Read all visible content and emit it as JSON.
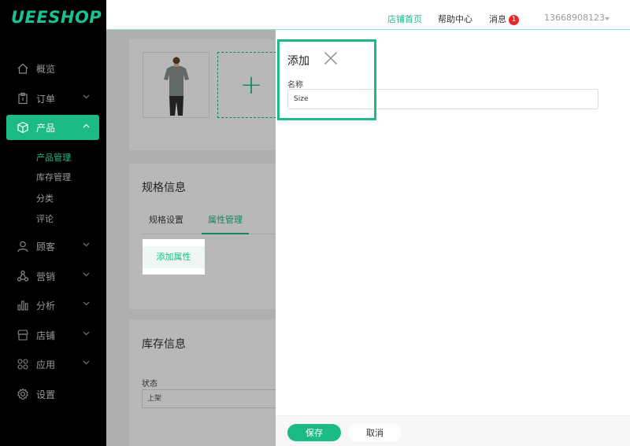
{
  "logo": "UEESHOP",
  "header": {
    "store_home": "店铺首页",
    "help_center": "帮助中心",
    "messages": "消息",
    "message_count": "1",
    "phone": "13668908123"
  },
  "sidebar": {
    "items": [
      {
        "label": "概览",
        "icon": "home-icon"
      },
      {
        "label": "订单",
        "icon": "clipboard-icon"
      },
      {
        "label": "产品",
        "icon": "box-icon"
      },
      {
        "label": "顾客",
        "icon": "user-icon"
      },
      {
        "label": "营销",
        "icon": "nodes-icon"
      },
      {
        "label": "分析",
        "icon": "bar-chart-icon"
      },
      {
        "label": "店铺",
        "icon": "store-icon"
      },
      {
        "label": "应用",
        "icon": "apps-icon"
      },
      {
        "label": "设置",
        "icon": "gear-icon"
      }
    ],
    "product_sub": [
      "产品管理",
      "库存管理",
      "分类",
      "评论"
    ]
  },
  "main": {
    "spec_title": "规格信息",
    "tabs": [
      "规格设置",
      "属性管理"
    ],
    "add_attribute": "添加属性",
    "inventory_title": "库存信息",
    "status_label": "状态",
    "status_value": "上架"
  },
  "panel": {
    "title": "添加",
    "name_label": "名称",
    "name_value": "Size",
    "save": "保存",
    "cancel": "取消"
  },
  "colors": {
    "accent": "#1cbb85",
    "badge": "#e8282b",
    "sidebar_bg": "#000000"
  }
}
